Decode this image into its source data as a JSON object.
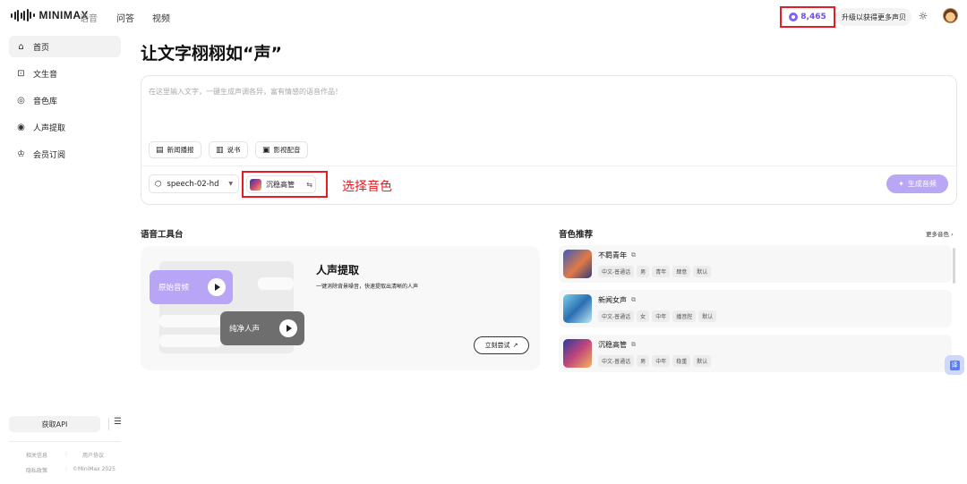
{
  "header": {
    "logo_text": "MINIMAX",
    "nav": [
      "语音",
      "问答",
      "视频"
    ],
    "credits": "8,465",
    "upgrade": "升级以获得更多声贝"
  },
  "sidebar": {
    "items": [
      {
        "label": "首页",
        "icon": "home-icon"
      },
      {
        "label": "文生音",
        "icon": "text-to-speech-icon"
      },
      {
        "label": "音色库",
        "icon": "voice-library-icon"
      },
      {
        "label": "人声提取",
        "icon": "vocal-extract-icon"
      },
      {
        "label": "会员订阅",
        "icon": "crown-icon"
      }
    ],
    "api_button": "获取API",
    "footer": {
      "about": "相关信息",
      "terms": "用户协议",
      "privacy": "隐私政策",
      "copyright": "©MiniMax 2025"
    }
  },
  "main": {
    "title": "让文字栩栩如“声”",
    "placeholder": "在这里输入文字，一键生成声调各异，富有情感的语音作品！",
    "chips": [
      "新闻播报",
      "说书",
      "影视配音"
    ],
    "model": "speech-02-hd",
    "voice": "沉稳高管",
    "annotation": "选择音色",
    "generate": "生成音频"
  },
  "tools": {
    "section_title": "语音工具台",
    "orig_label": "原始音频",
    "clean_label": "纯净人声",
    "title": "人声提取",
    "desc": "一键消除背景噪音，快速提取出清晰的人声",
    "try": "立刻尝试"
  },
  "voices": {
    "section_title": "音色推荐",
    "more": "更多音色",
    "items": [
      {
        "name": "不羁青年",
        "tags": [
          "中文-普通话",
          "男",
          "青年",
          "肆意",
          "默认"
        ]
      },
      {
        "name": "新闻女声",
        "tags": [
          "中文-普通话",
          "女",
          "中年",
          "播音腔",
          "默认"
        ]
      },
      {
        "name": "沉稳高管",
        "tags": [
          "中文-普通话",
          "男",
          "中年",
          "稳重",
          "默认"
        ]
      }
    ]
  },
  "colors": {
    "accent": "#7d63f7",
    "highlight_box": "#e51c23",
    "generate_button": "#b9a6f5"
  }
}
